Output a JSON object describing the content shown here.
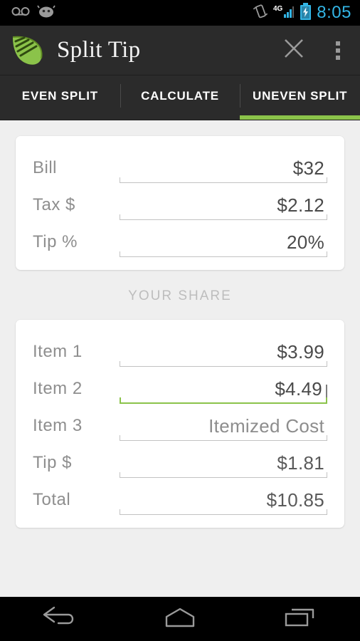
{
  "status_bar": {
    "icons": [
      "voicemail-icon",
      "android-head-icon"
    ],
    "right_icons": [
      "vibrate-icon",
      "4g-signal-icon",
      "battery-charging-icon"
    ],
    "network_label": "4G",
    "time": "8:05",
    "time_color": "#33b5e5"
  },
  "action_bar": {
    "logo": "leaf-logo",
    "title": "Split Tip",
    "close_icon": "close-icon",
    "overflow_icon": "overflow-menu-icon"
  },
  "tabs": {
    "accent_color": "#8bc34a",
    "items": [
      {
        "label": "EVEN SPLIT",
        "active": false
      },
      {
        "label": "CALCULATE",
        "active": false
      },
      {
        "label": "UNEVEN SPLIT",
        "active": true
      }
    ]
  },
  "bill_card": {
    "rows": [
      {
        "label": "Bill",
        "value": "$32"
      },
      {
        "label": "Tax $",
        "value": "$2.12"
      },
      {
        "label": "Tip %",
        "value": "20%"
      }
    ]
  },
  "your_share": {
    "section_title": "YOUR SHARE",
    "rows": [
      {
        "label": "Item  1",
        "value": "$3.99",
        "focused": false,
        "placeholder": false
      },
      {
        "label": "Item  2",
        "value": "$4.49",
        "focused": true,
        "placeholder": false
      },
      {
        "label": "Item  3",
        "value": "Itemized Cost",
        "focused": false,
        "placeholder": true
      },
      {
        "label": "Tip $",
        "value": "$1.81",
        "focused": false,
        "placeholder": false
      },
      {
        "label": "Total",
        "value": "$10.85",
        "focused": false,
        "placeholder": false
      }
    ]
  },
  "nav_bar": {
    "back": "back-icon",
    "home": "home-icon",
    "recents": "recents-icon"
  }
}
